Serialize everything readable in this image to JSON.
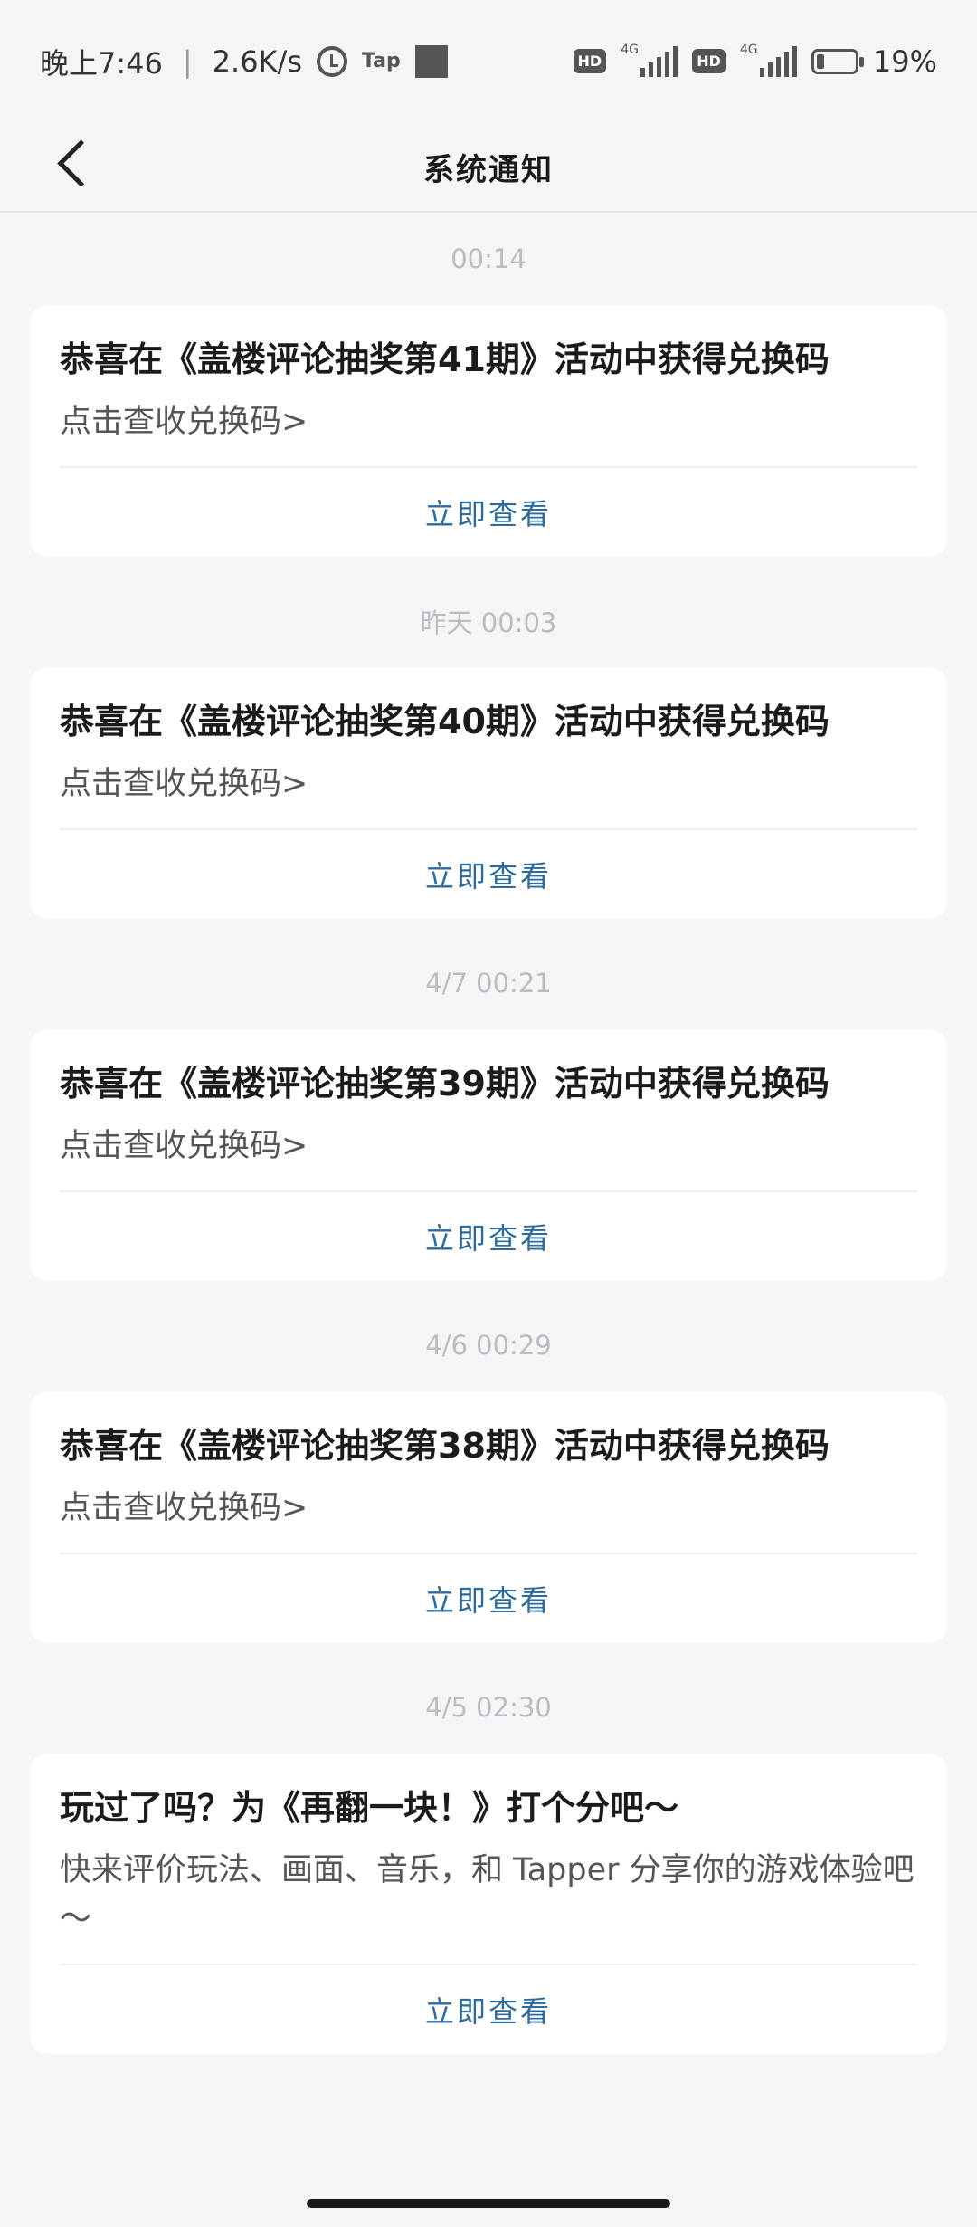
{
  "status_bar": {
    "time": "晚上7:46",
    "net_speed": "2.6K/s",
    "tap_label": "Tap",
    "hd1": "HD",
    "net1": "4G",
    "hd2": "HD",
    "net2": "4G",
    "battery": "19%",
    "battery_level": 0.19
  },
  "nav": {
    "title": "系统通知"
  },
  "notifications": [
    {
      "time": "00:14",
      "title": "恭喜在《盖楼评论抽奖第41期》活动中获得兑换码",
      "body": "点击查收兑换码>",
      "action": "立即查看"
    },
    {
      "time": "昨天  00:03",
      "title": "恭喜在《盖楼评论抽奖第40期》活动中获得兑换码",
      "body": "点击查收兑换码>",
      "action": "立即查看"
    },
    {
      "time": "4/7  00:21",
      "title": "恭喜在《盖楼评论抽奖第39期》活动中获得兑换码",
      "body": "点击查收兑换码>",
      "action": "立即查看"
    },
    {
      "time": "4/6  00:29",
      "title": "恭喜在《盖楼评论抽奖第38期》活动中获得兑换码",
      "body": "点击查收兑换码>",
      "action": "立即查看"
    },
    {
      "time": "4/5  02:30",
      "title": "玩过了吗？为《再翻一块！》打个分吧～",
      "body": "快来评价玩法、画面、音乐，和 Tapper 分享你的游戏体验吧～",
      "action": "立即查看"
    }
  ],
  "colors": {
    "background": "#f4f5f7",
    "card": "#ffffff",
    "action": "#2d6a9f",
    "timestamp": "#b9bcc1"
  }
}
